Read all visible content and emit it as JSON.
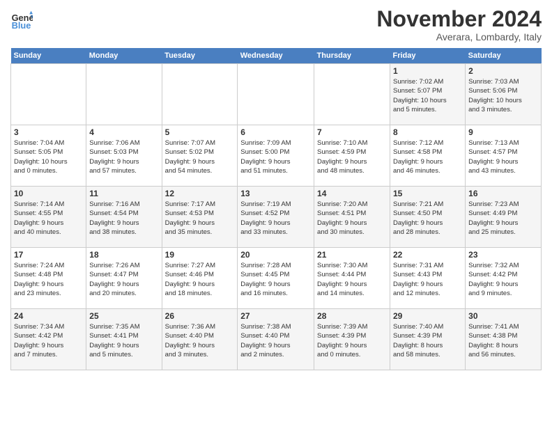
{
  "header": {
    "logo_line1": "General",
    "logo_line2": "Blue",
    "month_title": "November 2024",
    "location": "Averara, Lombardy, Italy"
  },
  "calendar": {
    "days_of_week": [
      "Sunday",
      "Monday",
      "Tuesday",
      "Wednesday",
      "Thursday",
      "Friday",
      "Saturday"
    ],
    "weeks": [
      [
        {
          "day": "",
          "info": ""
        },
        {
          "day": "",
          "info": ""
        },
        {
          "day": "",
          "info": ""
        },
        {
          "day": "",
          "info": ""
        },
        {
          "day": "",
          "info": ""
        },
        {
          "day": "1",
          "info": "Sunrise: 7:02 AM\nSunset: 5:07 PM\nDaylight: 10 hours\nand 5 minutes."
        },
        {
          "day": "2",
          "info": "Sunrise: 7:03 AM\nSunset: 5:06 PM\nDaylight: 10 hours\nand 3 minutes."
        }
      ],
      [
        {
          "day": "3",
          "info": "Sunrise: 7:04 AM\nSunset: 5:05 PM\nDaylight: 10 hours\nand 0 minutes."
        },
        {
          "day": "4",
          "info": "Sunrise: 7:06 AM\nSunset: 5:03 PM\nDaylight: 9 hours\nand 57 minutes."
        },
        {
          "day": "5",
          "info": "Sunrise: 7:07 AM\nSunset: 5:02 PM\nDaylight: 9 hours\nand 54 minutes."
        },
        {
          "day": "6",
          "info": "Sunrise: 7:09 AM\nSunset: 5:00 PM\nDaylight: 9 hours\nand 51 minutes."
        },
        {
          "day": "7",
          "info": "Sunrise: 7:10 AM\nSunset: 4:59 PM\nDaylight: 9 hours\nand 48 minutes."
        },
        {
          "day": "8",
          "info": "Sunrise: 7:12 AM\nSunset: 4:58 PM\nDaylight: 9 hours\nand 46 minutes."
        },
        {
          "day": "9",
          "info": "Sunrise: 7:13 AM\nSunset: 4:57 PM\nDaylight: 9 hours\nand 43 minutes."
        }
      ],
      [
        {
          "day": "10",
          "info": "Sunrise: 7:14 AM\nSunset: 4:55 PM\nDaylight: 9 hours\nand 40 minutes."
        },
        {
          "day": "11",
          "info": "Sunrise: 7:16 AM\nSunset: 4:54 PM\nDaylight: 9 hours\nand 38 minutes."
        },
        {
          "day": "12",
          "info": "Sunrise: 7:17 AM\nSunset: 4:53 PM\nDaylight: 9 hours\nand 35 minutes."
        },
        {
          "day": "13",
          "info": "Sunrise: 7:19 AM\nSunset: 4:52 PM\nDaylight: 9 hours\nand 33 minutes."
        },
        {
          "day": "14",
          "info": "Sunrise: 7:20 AM\nSunset: 4:51 PM\nDaylight: 9 hours\nand 30 minutes."
        },
        {
          "day": "15",
          "info": "Sunrise: 7:21 AM\nSunset: 4:50 PM\nDaylight: 9 hours\nand 28 minutes."
        },
        {
          "day": "16",
          "info": "Sunrise: 7:23 AM\nSunset: 4:49 PM\nDaylight: 9 hours\nand 25 minutes."
        }
      ],
      [
        {
          "day": "17",
          "info": "Sunrise: 7:24 AM\nSunset: 4:48 PM\nDaylight: 9 hours\nand 23 minutes."
        },
        {
          "day": "18",
          "info": "Sunrise: 7:26 AM\nSunset: 4:47 PM\nDaylight: 9 hours\nand 20 minutes."
        },
        {
          "day": "19",
          "info": "Sunrise: 7:27 AM\nSunset: 4:46 PM\nDaylight: 9 hours\nand 18 minutes."
        },
        {
          "day": "20",
          "info": "Sunrise: 7:28 AM\nSunset: 4:45 PM\nDaylight: 9 hours\nand 16 minutes."
        },
        {
          "day": "21",
          "info": "Sunrise: 7:30 AM\nSunset: 4:44 PM\nDaylight: 9 hours\nand 14 minutes."
        },
        {
          "day": "22",
          "info": "Sunrise: 7:31 AM\nSunset: 4:43 PM\nDaylight: 9 hours\nand 12 minutes."
        },
        {
          "day": "23",
          "info": "Sunrise: 7:32 AM\nSunset: 4:42 PM\nDaylight: 9 hours\nand 9 minutes."
        }
      ],
      [
        {
          "day": "24",
          "info": "Sunrise: 7:34 AM\nSunset: 4:42 PM\nDaylight: 9 hours\nand 7 minutes."
        },
        {
          "day": "25",
          "info": "Sunrise: 7:35 AM\nSunset: 4:41 PM\nDaylight: 9 hours\nand 5 minutes."
        },
        {
          "day": "26",
          "info": "Sunrise: 7:36 AM\nSunset: 4:40 PM\nDaylight: 9 hours\nand 3 minutes."
        },
        {
          "day": "27",
          "info": "Sunrise: 7:38 AM\nSunset: 4:40 PM\nDaylight: 9 hours\nand 2 minutes."
        },
        {
          "day": "28",
          "info": "Sunrise: 7:39 AM\nSunset: 4:39 PM\nDaylight: 9 hours\nand 0 minutes."
        },
        {
          "day": "29",
          "info": "Sunrise: 7:40 AM\nSunset: 4:39 PM\nDaylight: 8 hours\nand 58 minutes."
        },
        {
          "day": "30",
          "info": "Sunrise: 7:41 AM\nSunset: 4:38 PM\nDaylight: 8 hours\nand 56 minutes."
        }
      ]
    ]
  }
}
